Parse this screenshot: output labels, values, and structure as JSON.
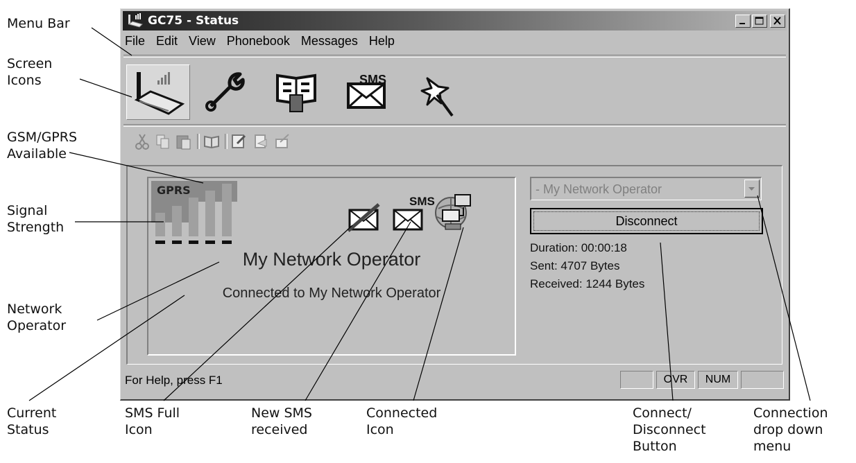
{
  "window": {
    "title": "GC75 - Status"
  },
  "menu": [
    "File",
    "Edit",
    "View",
    "Phonebook",
    "Messages",
    "Help"
  ],
  "big_toolbar": [
    "status-icon",
    "settings-wrench-icon",
    "phonebook-icon",
    "sms-icon",
    "wizard-wand-icon"
  ],
  "small_toolbar": [
    "cut-icon",
    "copy-icon",
    "paste-icon",
    "book-icon",
    "edit-icon",
    "message-icon",
    "send-icon"
  ],
  "status_panel": {
    "network_badge": "GPRS",
    "sms_badge": "SMS",
    "operator_name": "My Network Operator",
    "status_text": "Connected to My Network Operator"
  },
  "connection": {
    "operator_select": "- My Network Operator",
    "button_label": "Disconnect",
    "duration": "Duration: 00:00:18",
    "sent": "Sent: 4707 Bytes",
    "received": "Received: 1244 Bytes"
  },
  "statusbar": {
    "help": "For Help, press F1",
    "ovr": "OVR",
    "num": "NUM"
  },
  "callouts": {
    "menu_bar": "Menu Bar",
    "screen_icons": "Screen\nIcons",
    "gsm_gprs": "GSM/GPRS\nAvailable",
    "signal": "Signal\nStrength",
    "network_operator": "Network\nOperator",
    "current_status": "Current\nStatus",
    "sms_full": "SMS Full\nIcon",
    "new_sms": "New SMS\nreceived",
    "connected_icon": "Connected\nIcon",
    "connect_button": "Connect/\nDisconnect\nButton",
    "connection_menu": "Connection\ndrop down\nmenu"
  }
}
